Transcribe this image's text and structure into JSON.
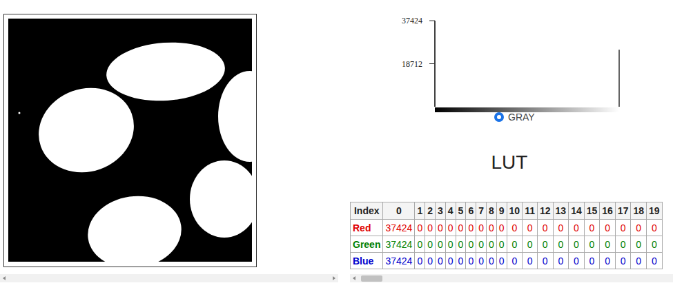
{
  "histogram": {
    "ticks": [
      "37424",
      "18712"
    ],
    "values": [
      37424,
      0,
      0,
      0,
      0,
      0,
      0,
      0,
      0,
      0,
      0,
      0,
      0,
      0,
      0,
      0,
      0,
      0,
      0,
      0,
      0,
      0,
      0,
      0,
      0,
      0,
      0,
      0,
      0,
      0,
      0,
      0,
      0,
      0,
      0,
      0,
      0,
      0,
      0,
      0,
      0,
      0,
      0,
      0,
      0,
      0,
      0,
      0,
      0,
      0,
      0,
      0,
      0,
      0,
      0,
      0,
      0,
      0,
      0,
      0,
      0,
      0,
      0,
      0,
      0,
      0,
      0,
      0,
      0,
      0,
      0,
      0,
      0,
      0,
      0,
      0,
      0,
      0,
      0,
      0,
      0,
      0,
      0,
      0,
      0,
      0,
      0,
      0,
      0,
      0,
      0,
      0,
      0,
      0,
      0,
      0,
      0,
      0,
      0,
      0,
      0,
      0,
      0,
      0,
      0,
      0,
      0,
      0,
      0,
      0,
      0,
      0,
      0,
      0,
      0,
      0,
      0,
      0,
      0,
      0,
      0,
      0,
      0,
      0,
      0,
      0,
      0,
      0,
      0,
      0,
      0,
      0,
      0,
      0,
      0,
      0,
      0,
      0,
      0,
      0,
      0,
      0,
      0,
      0,
      0,
      0,
      0,
      0,
      0,
      0,
      0,
      0,
      0,
      0,
      0,
      0,
      0,
      0,
      0,
      0,
      0,
      0,
      0,
      0,
      0,
      0,
      0,
      0,
      0,
      0,
      0,
      0,
      0,
      0,
      0,
      0,
      0,
      0,
      0,
      0,
      0,
      0,
      0,
      0,
      0,
      0,
      0,
      0,
      0,
      0,
      0,
      0,
      0,
      0,
      0,
      0,
      0,
      0,
      0,
      0,
      0,
      0,
      0,
      0,
      0,
      0,
      0,
      0,
      0,
      0,
      0,
      0,
      0,
      0,
      0,
      0,
      0,
      0,
      0,
      0,
      0,
      0,
      0,
      0,
      0,
      0,
      0,
      0,
      0,
      0,
      0,
      0,
      0,
      0,
      0,
      0,
      0,
      0,
      0,
      0,
      0,
      0,
      0,
      0,
      0,
      0,
      0,
      0,
      0,
      0,
      0,
      0,
      0,
      0,
      0,
      24800
    ]
  },
  "channel_options": [
    {
      "label": "GRAY",
      "selected": true
    }
  ],
  "lut": {
    "title": "LUT",
    "columns": [
      "Index",
      "0",
      "1",
      "2",
      "3",
      "4",
      "5",
      "6",
      "7",
      "8",
      "9",
      "10",
      "11",
      "12",
      "13",
      "14",
      "15",
      "16",
      "17",
      "18",
      "19"
    ],
    "rows": [
      {
        "label": "Red",
        "color": "#e00000",
        "values": [
          "37424",
          "0",
          "0",
          "0",
          "0",
          "0",
          "0",
          "0",
          "0",
          "0",
          "0",
          "0",
          "0",
          "0",
          "0",
          "0",
          "0",
          "0",
          "0",
          "0"
        ]
      },
      {
        "label": "Green",
        "color": "#008000",
        "values": [
          "37424",
          "0",
          "0",
          "0",
          "0",
          "0",
          "0",
          "0",
          "0",
          "0",
          "0",
          "0",
          "0",
          "0",
          "0",
          "0",
          "0",
          "0",
          "0",
          "0"
        ]
      },
      {
        "label": "Blue",
        "color": "#0000cc",
        "values": [
          "37424",
          "0",
          "0",
          "0",
          "0",
          "0",
          "0",
          "0",
          "0",
          "0",
          "0",
          "0",
          "0",
          "0",
          "0",
          "0",
          "0",
          "0",
          "0",
          "0"
        ]
      }
    ]
  }
}
